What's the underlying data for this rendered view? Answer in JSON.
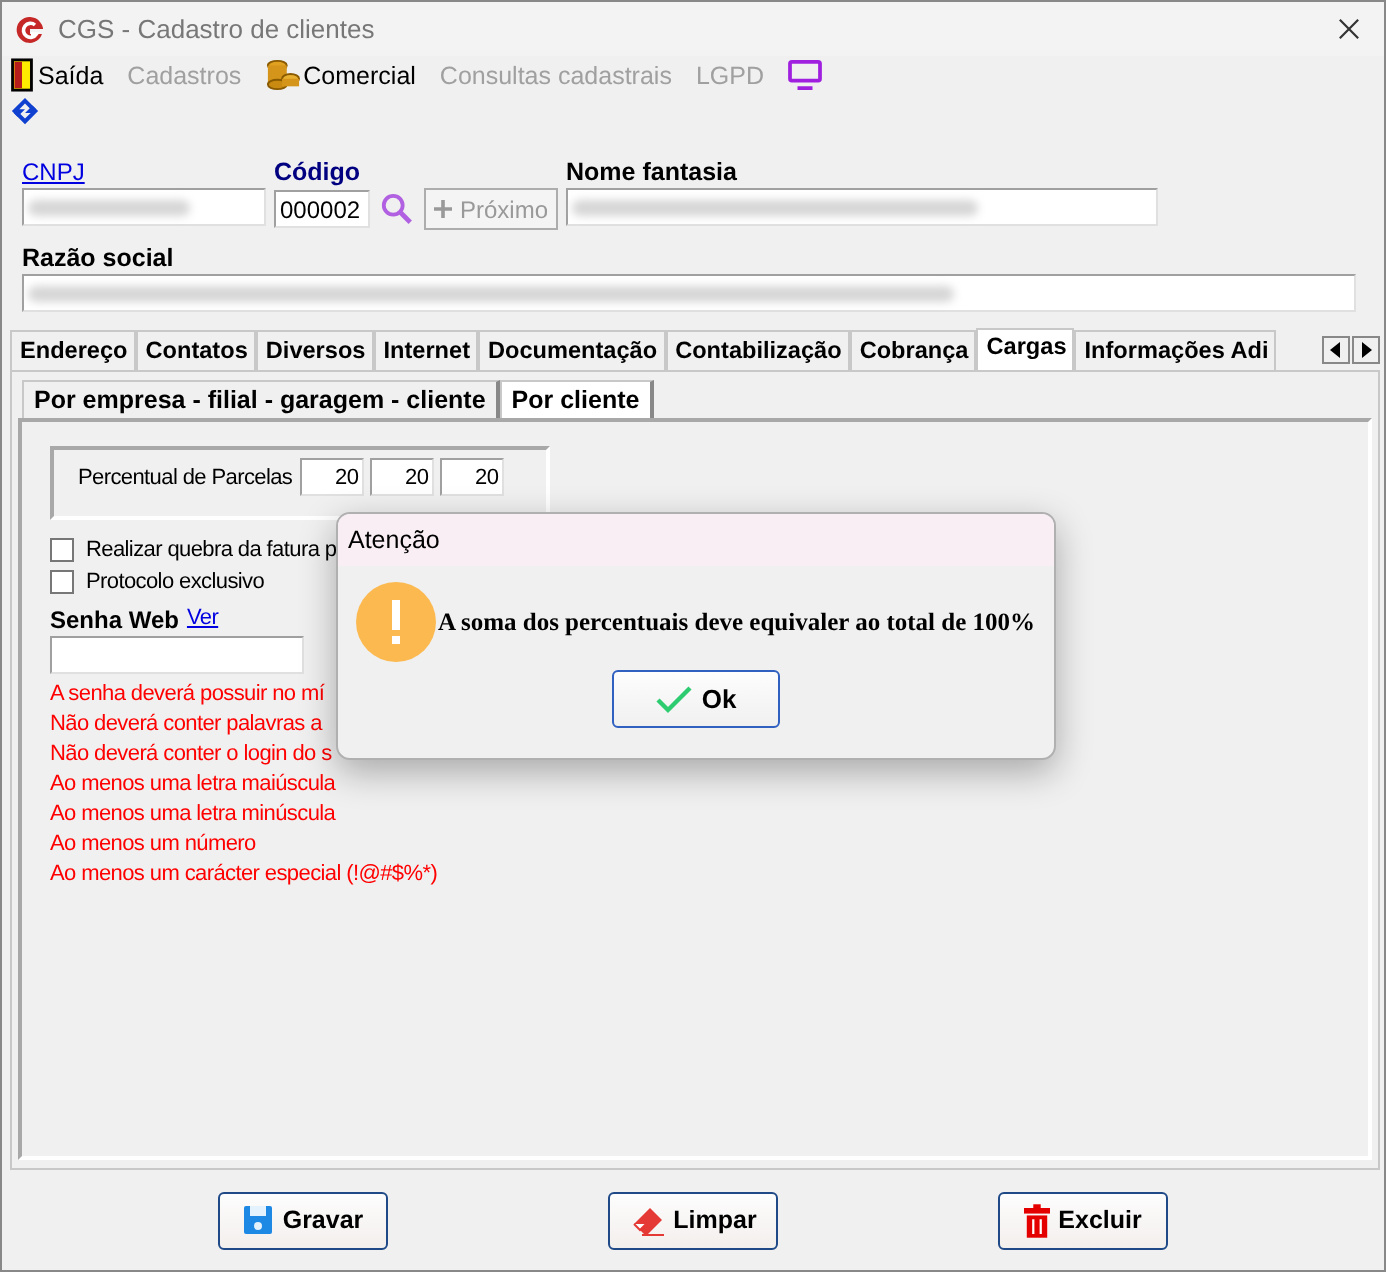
{
  "window": {
    "title": "CGS - Cadastro de clientes"
  },
  "menu": [
    {
      "label": "Saída",
      "kind": "exit",
      "disabled": false
    },
    {
      "label": "Cadastros",
      "kind": "plain",
      "disabled": true
    },
    {
      "label": "Comercial",
      "kind": "commercial",
      "disabled": false
    },
    {
      "label": "Consultas cadastrais",
      "kind": "plain",
      "disabled": true
    },
    {
      "label": "LGPD",
      "kind": "plain",
      "disabled": true
    },
    {
      "kind": "screen",
      "disabled": false
    }
  ],
  "header": {
    "cnpj": {
      "label": "CNPJ",
      "redacted": true
    },
    "codigo": {
      "label": "Código",
      "value": "000002"
    },
    "next_button": {
      "label": "Próximo",
      "disabled": true
    },
    "nome_fantasia": {
      "label": "Nome fantasia",
      "redacted": true
    },
    "razao_social": {
      "label": "Razão social",
      "redacted": true
    }
  },
  "tabs": [
    {
      "label": "Endereço",
      "selected": false
    },
    {
      "label": "Contatos",
      "selected": false
    },
    {
      "label": "Diversos",
      "selected": false
    },
    {
      "label": "Internet",
      "selected": false
    },
    {
      "label": "Documentação",
      "selected": false
    },
    {
      "label": "Contabilização",
      "selected": false
    },
    {
      "label": "Cobrança",
      "selected": false
    },
    {
      "label": "Cargas",
      "selected": true
    },
    {
      "label": "Informações Adi",
      "selected": false
    }
  ],
  "subtabs": [
    {
      "label": "Por empresa - filial - garagem - cliente",
      "selected": false
    },
    {
      "label": "Por cliente",
      "selected": true
    }
  ],
  "parcelas": {
    "label": "Percentual de Parcelas",
    "values": [
      "20",
      "20",
      "20"
    ]
  },
  "checkboxes": [
    {
      "label": "Realizar quebra da fatura p",
      "checked": false
    },
    {
      "label": "Protocolo exclusivo",
      "checked": false
    }
  ],
  "senha": {
    "label": "Senha Web",
    "link": "Ver"
  },
  "rules": [
    "A senha deverá possuir no mí",
    "Não deverá conter palavras a",
    "Não deverá conter o login do s",
    "Ao menos uma letra maiúscula",
    "Ao menos uma letra minúscula",
    "Ao menos um número",
    "Ao menos um carácter especial (!@#$%*)"
  ],
  "dialog": {
    "title": "Atenção",
    "message": "A soma dos percentuais deve equivaler ao total de 100%",
    "button": "Ok"
  },
  "buttons": [
    {
      "label": "Gravar",
      "kind": "save"
    },
    {
      "label": "Limpar",
      "kind": "clear"
    },
    {
      "label": "Excluir",
      "kind": "delete"
    }
  ]
}
